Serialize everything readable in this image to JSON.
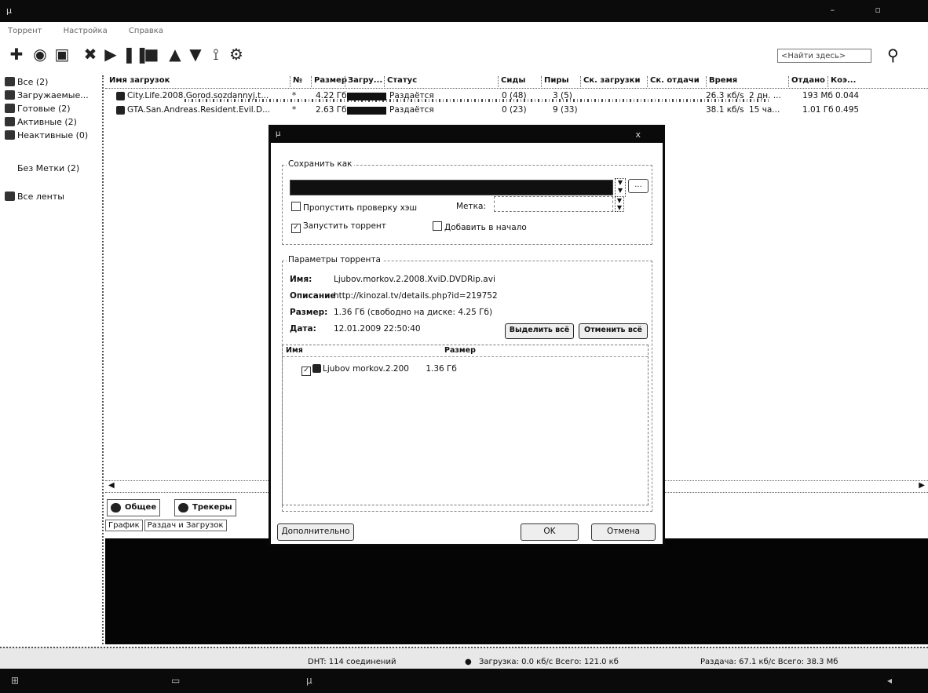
{
  "app": {
    "title_icon": "µ",
    "menu": [
      "Торрент",
      "Настройка",
      "Справка"
    ]
  },
  "search": {
    "placeholder": "<Найти здесь>"
  },
  "sidebar": {
    "items": [
      {
        "label": "Все (2)",
        "icon": "all-icon"
      },
      {
        "label": "Загружаемые...",
        "icon": "download-icon"
      },
      {
        "label": "Готовые (2)",
        "icon": "completed-icon"
      },
      {
        "label": "Активные (2)",
        "icon": "active-icon"
      },
      {
        "label": "Неактивные (0)",
        "icon": "inactive-icon"
      },
      {
        "label": "Без Метки (2)",
        "icon": ""
      },
      {
        "label": "Все ленты",
        "icon": "rss-icon"
      }
    ]
  },
  "table": {
    "columns": [
      "Имя загрузок",
      "№",
      "Размер",
      "Загру...",
      "Статус",
      "Сиды",
      "Пиры",
      "Ск. загрузки",
      "Ск. отдачи",
      "Время",
      "Отдано",
      "Коэ..."
    ],
    "rows": [
      {
        "name": "City.Life.2008.Gorod.sozdannyj.t...",
        "num": "*",
        "size": "4.22 Гб",
        "progress": 1.0,
        "status": "Раздаётся",
        "seeds": "0 (48)",
        "peers": "3 (5)",
        "down": "",
        "up": "26.3 кб/s",
        "time": "2 дн. ...",
        "uploaded": "193 Мб",
        "ratio": "0.044"
      },
      {
        "name": "GTA.San.Andreas.Resident.Evil.D...",
        "num": "*",
        "size": "2.63 Гб",
        "progress": 1.0,
        "status": "Раздаётся",
        "seeds": "0 (23)",
        "peers": "9 (33)",
        "down": "",
        "up": "38.1 кб/s",
        "time": "15 ча...",
        "uploaded": "1.01 Гб",
        "ratio": "0.495"
      }
    ]
  },
  "bottom_tabs": [
    "Общее",
    "Трекеры"
  ],
  "sub_tabs": [
    "График",
    "Раздач и Загрузок"
  ],
  "status": {
    "dht": "DHT: 114 соединений",
    "download": "Загрузка: 0.0 кб/с Всего: 121.0 кб",
    "upload": "Раздача: 67.1 кб/с Всего: 38.3 Мб"
  },
  "dialog": {
    "title": "µ",
    "close": "x",
    "save_as_label": "Сохранить как",
    "browse_label": "...",
    "skip_hash_label": "Пропустить проверку хэш",
    "labels_label": "Метка:",
    "start_torrent_label": "Запустить торрент",
    "add_top_label": "Добавить в начало",
    "params_label": "Параметры торрента",
    "name_key": "Имя:",
    "name_val": "Ljubov.morkov.2.2008.XviD.DVDRip.avi",
    "desc_key": "Описание",
    "desc_val": "http://kinozal.tv/details.php?id=219752",
    "size_key": "Размер:",
    "size_val": "1.36 Гб (свободно на диске: 4.25 Гб)",
    "date_key": "Дата:",
    "date_val": "12.01.2009 22:50:40",
    "select_all": "Выделить всё",
    "deselect_all": "Отменить всё",
    "file_cols": [
      "Имя",
      "Размер"
    ],
    "file_row": {
      "name": "Ljubov morkov.2.200",
      "size": "1.36 Гб"
    },
    "advanced": "Дополнительно",
    "ok": "OK",
    "cancel": "Отмена"
  }
}
